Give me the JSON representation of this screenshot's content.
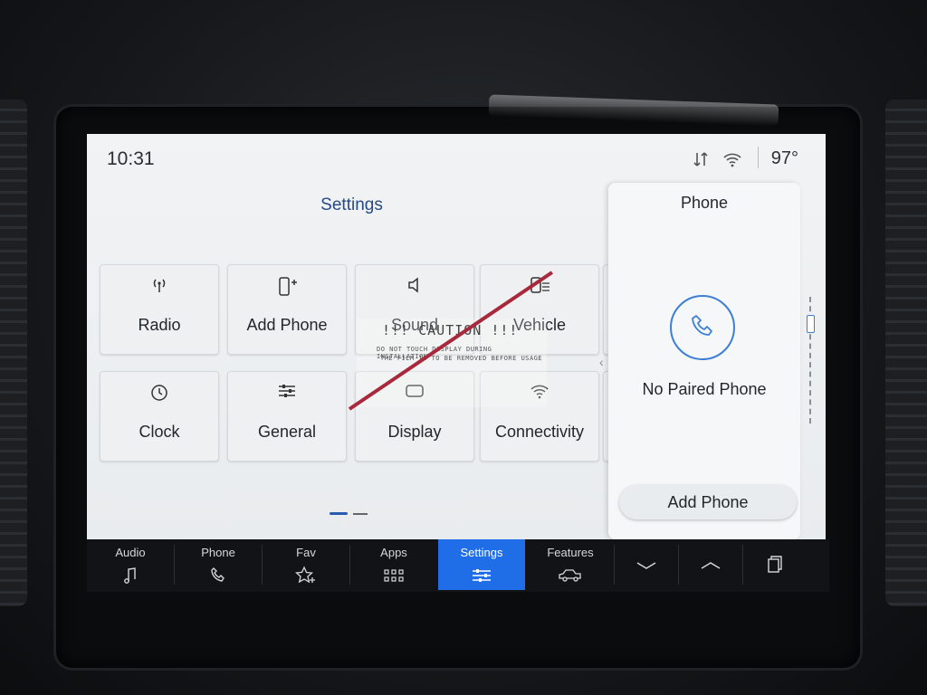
{
  "status_bar": {
    "time": "10:31",
    "temperature": "97°",
    "icons": [
      "data-transfer-icon",
      "wifi-hotspot-icon"
    ]
  },
  "settings": {
    "title": "Settings",
    "tiles": [
      {
        "label": "Radio",
        "icon": "antenna-icon"
      },
      {
        "label": "Add Phone",
        "icon": "phone-add-icon"
      },
      {
        "label": "Sound",
        "icon": "speaker-icon"
      },
      {
        "label": "Vehicle",
        "icon": "vehicle-settings-icon"
      },
      {
        "label": "Clock",
        "icon": "clock-icon"
      },
      {
        "label": "General",
        "icon": "sliders-icon"
      },
      {
        "label": "Display",
        "icon": "display-icon"
      },
      {
        "label": "Connectivity",
        "icon": "wifi-icon"
      }
    ]
  },
  "sticker": {
    "heading": "!!! CAUTION !!!",
    "line1": "DO NOT TOUCH DISPLAY DURING INSTALLATION",
    "line2": "THE FILM IS TO BE REMOVED BEFORE USAGE"
  },
  "phone_panel": {
    "title": "Phone",
    "status": "No Paired Phone",
    "button": "Add Phone"
  },
  "nav": [
    {
      "label": "Audio",
      "icon": "music-note-icon",
      "active": false
    },
    {
      "label": "Phone",
      "icon": "phone-icon",
      "active": false
    },
    {
      "label": "Fav",
      "icon": "star-plus-icon",
      "active": false
    },
    {
      "label": "Apps",
      "icon": "apps-grid-icon",
      "active": false
    },
    {
      "label": "Settings",
      "icon": "sliders-icon",
      "active": true
    },
    {
      "label": "Features",
      "icon": "truck-icon",
      "active": false
    }
  ],
  "colors": {
    "accent": "#1f6ee8",
    "title_blue": "#264a86",
    "screen_bg": "#eef0f1",
    "nav_bg": "#111316"
  }
}
